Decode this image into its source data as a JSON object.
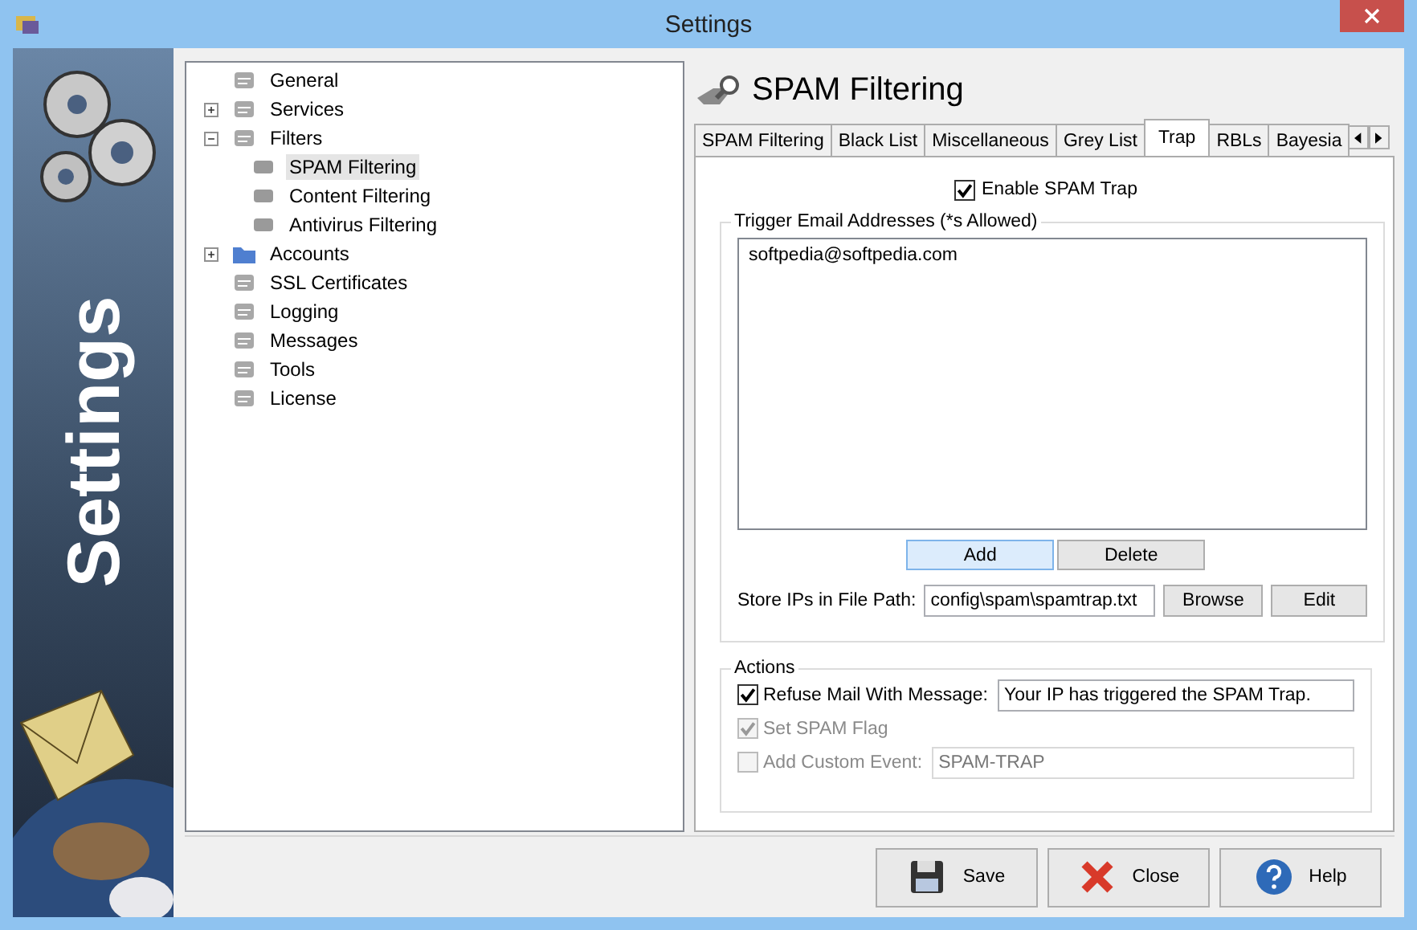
{
  "window": {
    "title": "Settings"
  },
  "banner": {
    "title": "Settings"
  },
  "tree": [
    {
      "label": "General",
      "selected": false
    },
    {
      "label": "Services",
      "selected": false,
      "expanded": false
    },
    {
      "label": "Filters",
      "selected": false,
      "expanded": true,
      "children": [
        {
          "label": "SPAM Filtering",
          "selected": true
        },
        {
          "label": "Content Filtering",
          "selected": false
        },
        {
          "label": "Antivirus Filtering",
          "selected": false
        }
      ]
    },
    {
      "label": "Accounts",
      "selected": false,
      "expanded": false
    },
    {
      "label": "SSL Certificates",
      "selected": false
    },
    {
      "label": "Logging",
      "selected": false
    },
    {
      "label": "Messages",
      "selected": false
    },
    {
      "label": "Tools",
      "selected": false
    },
    {
      "label": "License",
      "selected": false
    }
  ],
  "page": {
    "title": "SPAM Filtering"
  },
  "tabs": [
    {
      "label": "SPAM Filtering",
      "selected": false
    },
    {
      "label": "Black List",
      "selected": false
    },
    {
      "label": "Miscellaneous",
      "selected": false
    },
    {
      "label": "Grey List",
      "selected": false
    },
    {
      "label": "Trap",
      "selected": true
    },
    {
      "label": "RBLs",
      "selected": false
    },
    {
      "label": "Bayesia",
      "selected": false
    }
  ],
  "enable_trap": {
    "label": "Enable SPAM Trap",
    "checked": true
  },
  "trigger_group": {
    "title": "Trigger Email Addresses (*s Allowed)",
    "addresses": [
      "softpedia@softpedia.com"
    ],
    "buttons": [
      {
        "label": "Add",
        "default": true
      },
      {
        "label": "Delete",
        "default": false
      }
    ],
    "path_label": "Store IPs in File Path:",
    "path_value": "config\\spam\\spamtrap.txt",
    "path_buttons": [
      "Browse",
      "Edit"
    ]
  },
  "actions": {
    "title": "Actions",
    "rows": [
      {
        "label": "Refuse Mail With Message:",
        "checked": true,
        "disabled": false,
        "value": "Your IP has triggered the SPAM Trap."
      },
      {
        "label": "Set SPAM Flag",
        "checked": true,
        "disabled": true
      },
      {
        "label": "Add Custom Event:",
        "checked": false,
        "disabled": true,
        "value": "SPAM-TRAP"
      }
    ]
  },
  "footer_buttons": [
    {
      "label": "Save",
      "kind": "save"
    },
    {
      "label": "Close",
      "kind": "close"
    },
    {
      "label": "Help",
      "kind": "help"
    }
  ]
}
